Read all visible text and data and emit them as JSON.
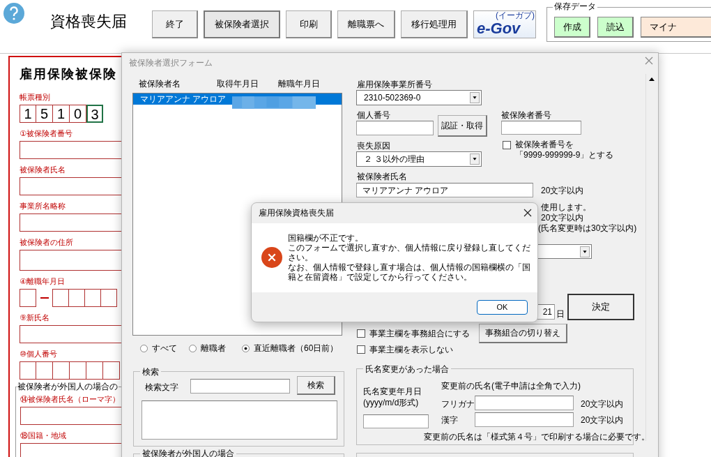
{
  "app": {
    "title": "資格喪失届"
  },
  "toolbar": {
    "buttons": [
      {
        "label": "終了",
        "pressed": false
      },
      {
        "label": "被保険者選択",
        "pressed": true
      },
      {
        "label": "印刷",
        "pressed": false
      },
      {
        "label": "離職票へ",
        "pressed": false
      },
      {
        "label": "移行処理用",
        "pressed": false
      }
    ],
    "logo": {
      "text": "e-Gov",
      "ruby": "(イーガブ)"
    }
  },
  "save_data": {
    "title": "保存データ",
    "buttons": [
      {
        "label": "作成",
        "color": "#ccffcc"
      },
      {
        "label": "読込",
        "color": "#ccffcc"
      },
      {
        "label": "マイナ",
        "color": "#fde9d9"
      }
    ]
  },
  "sheet": {
    "title": "雇用保険被保険",
    "form_type": {
      "label": "帳票種別",
      "digits": [
        {
          "value": "1",
          "selected": false
        },
        {
          "value": "5",
          "selected": false
        },
        {
          "value": "1",
          "selected": false
        },
        {
          "value": "0",
          "selected": false
        },
        {
          "value": "3",
          "selected": true
        }
      ]
    },
    "fields": [
      {
        "label": "①被保険者番号",
        "kind": "box"
      },
      {
        "label": "被保険者氏名",
        "kind": "box"
      },
      {
        "label": "事業所名略称",
        "kind": "box"
      },
      {
        "label": "被保険者の住所",
        "kind": "tall"
      },
      {
        "label": "④離職年月日",
        "kind": "date"
      },
      {
        "label": "⑨新氏名",
        "kind": "box"
      },
      {
        "label": "⑩個人番号",
        "kind": "cells"
      }
    ],
    "foreign_group": {
      "title": "被保険者が外国人の場合の",
      "fields": [
        {
          "label": "⑭被保険者氏名（ローマ字）",
          "kind": "box"
        },
        {
          "label": "⑱国籍・地域",
          "kind": "box"
        }
      ]
    }
  },
  "form": {
    "title": "被保険者選択フォーム",
    "list": {
      "columns": [
        "被保険者名",
        "取得年月日",
        "離職年月日"
      ],
      "rows": [
        {
          "name": "マリアアンナ アウロア",
          "selected": true
        }
      ]
    },
    "filters": [
      {
        "label": "すべて",
        "selected": false
      },
      {
        "label": "離職者",
        "selected": false
      },
      {
        "label": "直近離職者（60日前）",
        "selected": true
      }
    ],
    "search": {
      "title": "検索",
      "label": "検索文字",
      "button": "検索"
    },
    "foreign_group": {
      "title": "被保険者が外国人の場合"
    },
    "office_number": {
      "label": "雇用保険事業所番号",
      "value": "2310-502369-0"
    },
    "my_number": {
      "label": "個人番号",
      "button": "認証・取得"
    },
    "insured_number": {
      "label": "被保険者番号"
    },
    "dummy_number": {
      "lines": [
        "被保険者番号を",
        "「9999-999999-9」とする"
      ],
      "checked": false
    },
    "loss_reason": {
      "label": "喪失原因",
      "value": "２ ３以外の理由"
    },
    "insured_name": {
      "label": "被保険者氏名",
      "value": "マリアアンナ アウロア",
      "limit": "20文字以内"
    },
    "hidden_notes": [
      "使用します。",
      "20文字以内",
      "(氏名変更時は30文字以内)"
    ],
    "day": {
      "value": "21",
      "unit": "日"
    },
    "confirm_button": "決定",
    "options": [
      {
        "label": "事業主欄を事務組合にする",
        "checked": false
      },
      {
        "label": "事業主欄を表示しない",
        "checked": false
      }
    ],
    "switch_button": "事務組合の切り替え",
    "name_change": {
      "title": "氏名変更があった場合",
      "date_label": [
        "氏名変更年月日",
        "(yyyy/m/d形式)"
      ],
      "previous_label": "変更前の氏名(電子申請は全角で入力)",
      "kana_label": "フリガナ",
      "kanji_label": "漢字",
      "kana_limit": "20文字以内",
      "kanji_limit": "20文字以内",
      "note": "変更前の氏名は「様式第４号」で印刷する場合に必要です。"
    }
  },
  "message_box": {
    "title": "雇用保険資格喪失届",
    "message": [
      "国籍欄が不正です。",
      "このフォームで選択し直すか、個人情報に戻り登録し直してください。",
      "なお、個人情報で登録し直す場合は、個人情報の国籍欄横の「国籍と在留資格」で設定してから行ってください。"
    ],
    "button": "OK"
  }
}
